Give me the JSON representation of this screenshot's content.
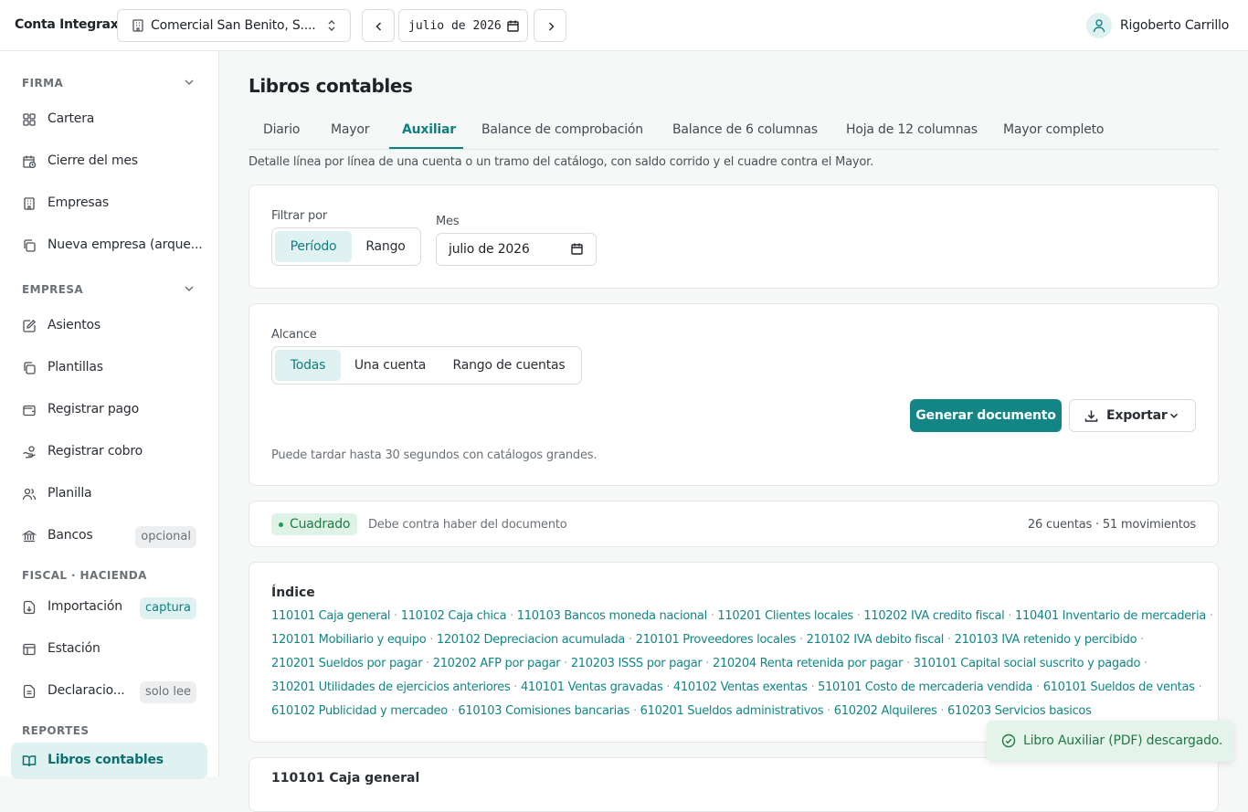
{
  "app": {
    "title": "Conta Integrax"
  },
  "company": {
    "name": "Comercial San Benito, S...."
  },
  "period_nav": {
    "month_value": "julio de 2026"
  },
  "user": {
    "name": "Rigoberto Carrillo"
  },
  "sidebar": {
    "sections": {
      "firma": "FIRMA",
      "empresa": "EMPRESA",
      "fiscal": "FISCAL · HACIENDA",
      "reportes": "REPORTES"
    },
    "items": {
      "cartera": "Cartera",
      "cierre": "Cierre del mes",
      "empresas": "Empresas",
      "nueva_empresa": "Nueva empresa (arque...",
      "asientos": "Asientos",
      "plantillas": "Plantillas",
      "registrar_pago": "Registrar pago",
      "registrar_cobro": "Registrar cobro",
      "planilla": "Planilla",
      "bancos": "Bancos",
      "importacion": "Importación",
      "estacion": "Estación",
      "declaraciones": "Declaracio...",
      "libros": "Libros contables"
    },
    "badges": {
      "bancos": "opcional",
      "importacion": "captura",
      "declaraciones": "solo lee"
    }
  },
  "page": {
    "title": "Libros contables",
    "description": "Detalle línea por línea de una cuenta o un tramo del catálogo, con saldo corrido y el cuadre contra el Mayor."
  },
  "tabs": {
    "diario": "Diario",
    "mayor": "Mayor",
    "auxiliar": "Auxiliar",
    "balance_comprobacion": "Balance de comprobación",
    "balance_6": "Balance de 6 columnas",
    "hoja_12": "Hoja de 12 columnas",
    "mayor_completo": "Mayor completo",
    "active": "Auxiliar"
  },
  "filter": {
    "label": "Filtrar por",
    "options": {
      "periodo": "Período",
      "rango": "Rango"
    },
    "selected": "Período",
    "month_label": "Mes",
    "month_value": "julio de 2026"
  },
  "scope": {
    "label": "Alcance",
    "options": {
      "todas": "Todas",
      "una": "Una cuenta",
      "rango": "Rango de cuentas"
    },
    "selected": "Todas",
    "generate": "Generar documento",
    "export": "Exportar",
    "hint": "Puede tardar hasta 30 segundos con catálogos grandes."
  },
  "status": {
    "badge": "Cuadrado",
    "description": "Debe contra haber del documento",
    "counts": "26 cuentas · 51 movimientos"
  },
  "index": {
    "title": "Índice",
    "lines": [
      [
        "110101 Caja general",
        "110102 Caja chica",
        "110103 Bancos moneda nacional",
        "110201 Clientes locales",
        "110202 IVA credito fiscal",
        "110401 Inventario de mercaderia"
      ],
      [
        "120101 Mobiliario y equipo",
        "120102 Depreciacion acumulada",
        "210101 Proveedores locales",
        "210102 IVA debito fiscal",
        "210103 IVA retenido y percibido"
      ],
      [
        "210201 Sueldos por pagar",
        "210202 AFP por pagar",
        "210203 ISSS por pagar",
        "210204 Renta retenida por pagar",
        "310101 Capital social suscrito y pagado"
      ],
      [
        "310201 Utilidades de ejercicios anteriores",
        "410101 Ventas gravadas",
        "410102 Ventas exentas",
        "510101 Costo de mercaderia vendida",
        "610101 Sueldos de ventas"
      ],
      [
        "610102 Publicidad y mercadeo",
        "610103 Comisiones bancarias",
        "610201 Sueldos administrativos",
        "610202 Alquileres",
        "610203 Servicios basicos"
      ]
    ]
  },
  "account_section": {
    "title": "110101 Caja general"
  },
  "toast": {
    "message": "Libro Auxiliar (PDF) descargado."
  },
  "colors": {
    "accent": "#138585",
    "accent_soft": "#dff1f1",
    "success": "#1f7a43"
  }
}
